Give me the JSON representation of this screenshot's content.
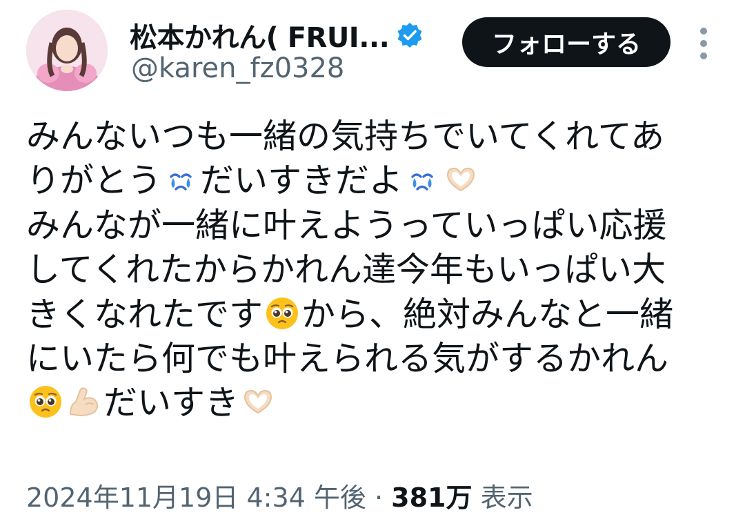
{
  "header": {
    "display_name": "松本かれん( FRUI...",
    "handle": "@karen_fz0328",
    "follow_label": "フォローする"
  },
  "body": {
    "line1": "みんないつも一緒の気持ちでいてくれてあ",
    "line2a": "りがとう",
    "line2b": "だいすきだよ",
    "line3": "みんなが一緒に叶えようっていっぱい応援",
    "line4": "してくれたからかれん達今年もいっぱい大",
    "line5a": "きくなれたです",
    "line5b": "から、絶対みんなと一緒",
    "line6": "にいたら何でも叶えられる気がするかれん",
    "line7": "だいすき"
  },
  "meta": {
    "timestamp": "2024年11月19日 4:34 午後 · ",
    "views_count": "381万",
    "views_label": " 表示"
  },
  "colors": {
    "text": "#0f1419",
    "secondary": "#536471",
    "verified": "#1d9bf0",
    "button_bg": "#0f1419"
  },
  "icons": [
    "verified-badge-icon",
    "more-options-icon",
    "crying-emoji",
    "heart-hands-emoji",
    "pleading-face-emoji",
    "flexed-biceps-emoji"
  ]
}
